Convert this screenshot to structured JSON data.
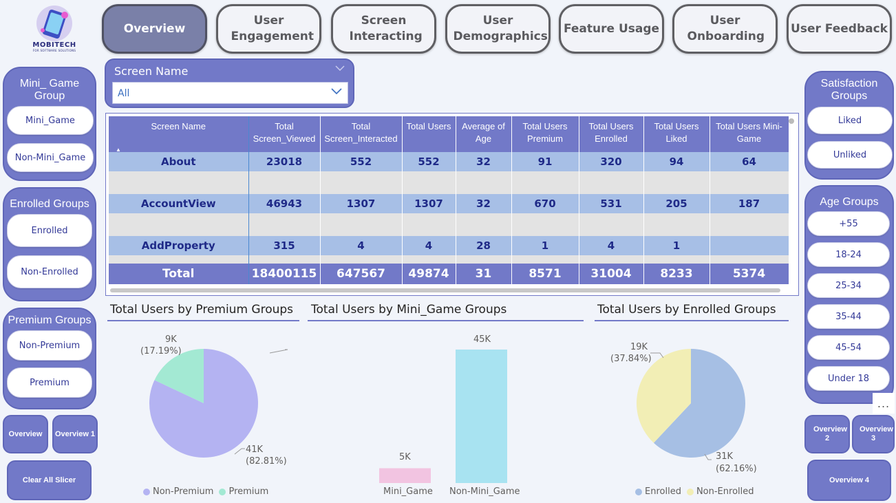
{
  "brand": {
    "name": "MOBITECH",
    "tagline": "FOR SOFTWARE SOLUTIONS"
  },
  "nav": {
    "tabs": [
      {
        "label": "Overview",
        "active": true
      },
      {
        "label": "User Engagement"
      },
      {
        "label": "Screen Interacting"
      },
      {
        "label": "User Demographics"
      },
      {
        "label": "Feature Usage"
      },
      {
        "label": "User Onboarding"
      },
      {
        "label": "User Feedback"
      }
    ]
  },
  "left": {
    "mini_game": {
      "title": "Mini_ Game Group",
      "options": [
        "Mini_Game",
        "Non-Mini_Game"
      ]
    },
    "enrolled": {
      "title": "Enrolled Groups",
      "options": [
        "Enrolled",
        "Non-Enrolled"
      ]
    },
    "premium": {
      "title": "Premium Groups",
      "options": [
        "Non-Premium",
        "Premium"
      ]
    },
    "buttons": {
      "overview": "Overview",
      "overview1": "Overview 1",
      "clear": "Clear All Slicer"
    }
  },
  "right": {
    "satisfaction": {
      "title": "Satisfaction Groups",
      "options": [
        "Liked",
        "Unliked"
      ]
    },
    "age": {
      "title": "Age Groups",
      "options": [
        "+55",
        "18-24",
        "25-34",
        "35-44",
        "45-54",
        "Under 18"
      ]
    },
    "buttons": {
      "overview2": "Overview 2",
      "overview3": "Overview 3",
      "overview4": "Overview 4"
    },
    "more": "..."
  },
  "screen_slicer": {
    "title": "Screen Name",
    "value": "All"
  },
  "table": {
    "headers": [
      "Screen Name",
      "Total Screen_Viewed",
      "Total Screen_Interacted",
      "Total Users",
      "Average of Age",
      "Total Users Premium",
      "Total Users Enrolled",
      "Total Users Liked",
      "Total Users Mini-Game"
    ],
    "rows": [
      [
        "About",
        "23018",
        "552",
        "552",
        "32",
        "91",
        "320",
        "94",
        "64"
      ],
      [
        "AccountView",
        "46943",
        "1307",
        "1307",
        "32",
        "670",
        "531",
        "205",
        "187"
      ],
      [
        "AddProperty",
        "315",
        "4",
        "4",
        "28",
        "1",
        "4",
        "1",
        ""
      ]
    ],
    "total": [
      "Total",
      "18400115",
      "647567",
      "49874",
      "31",
      "8571",
      "31004",
      "8233",
      "5374"
    ]
  },
  "charts": {
    "premium": {
      "title": "Total Users by Premium Groups"
    },
    "minigame": {
      "title": "Total Users by Mini_Game Groups"
    },
    "enrolled": {
      "title": "Total Users by Enrolled Groups"
    }
  },
  "chart_data": [
    {
      "type": "pie",
      "title": "Total Users by Premium Groups",
      "labels": [
        "Non-Premium",
        "Premium"
      ],
      "values": [
        41000,
        9000
      ],
      "percent": [
        82.81,
        17.19
      ],
      "data_labels": [
        {
          "value": "41K",
          "pct": "(82.81%)"
        },
        {
          "value": "9K",
          "pct": "(17.19%)"
        }
      ],
      "colors": [
        "#b4b3f2",
        "#a3e9d3"
      ],
      "legend": "bottom"
    },
    {
      "type": "bar",
      "title": "Total Users by Mini_Game Groups",
      "categories": [
        "Mini_Game",
        "Non-Mini_Game"
      ],
      "values": [
        5000,
        45000
      ],
      "data_labels": [
        "5K",
        "45K"
      ],
      "colors": [
        "#f2c4e1",
        "#a8e3f1"
      ]
    },
    {
      "type": "pie",
      "title": "Total Users by Enrolled Groups",
      "labels": [
        "Enrolled",
        "Non-Enrolled"
      ],
      "values": [
        31000,
        19000
      ],
      "percent": [
        62.16,
        37.84
      ],
      "data_labels": [
        {
          "value": "31K",
          "pct": "(62.16%)"
        },
        {
          "value": "19K",
          "pct": "(37.84%)"
        }
      ],
      "colors": [
        "#a6bfe4",
        "#f2eeb5"
      ],
      "legend": "bottom"
    }
  ]
}
